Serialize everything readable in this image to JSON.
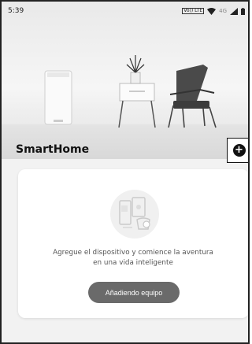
{
  "status_bar": {
    "time": "5:39",
    "volte": "Vo)) LTE",
    "signal_label": "4G"
  },
  "header": {
    "title": "SmartHome",
    "add_icon": "plus-circle-icon"
  },
  "empty_state": {
    "illustration": "smart-devices-icon",
    "message_line1": "Agregue el dispositivo y comience la aventura",
    "message_line2": "en una vida inteligente",
    "button_label": "Añadiendo equipo"
  },
  "colors": {
    "button": "#6a6a6a",
    "title": "#111111",
    "card": "#ffffff",
    "background": "#f2f2f2"
  }
}
